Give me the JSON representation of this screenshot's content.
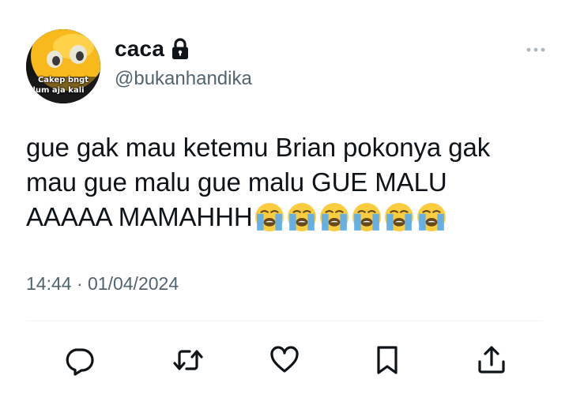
{
  "author": {
    "display_name": "caca",
    "handle": "@bukanhandika",
    "avatar_caption_line1": "Cakep bngt",
    "avatar_caption_line2": "lum aja kali",
    "protected_icon": "lock-icon"
  },
  "tweet": {
    "text_line1": "gue gak mau ketemu Brian pokonya gak",
    "text_line2": "mau gue malu gue malu GUE MALU",
    "text_line3": "AAAAA MAMAHHH",
    "emojis": [
      "loudly-crying-face",
      "loudly-crying-face",
      "loudly-crying-face",
      "loudly-crying-face",
      "loudly-crying-face",
      "loudly-crying-face"
    ],
    "timestamp": "14:44 · 01/04/2024"
  },
  "actions": [
    "reply-icon",
    "retweet-icon",
    "like-icon",
    "bookmark-icon",
    "share-icon"
  ],
  "colors": {
    "text": "#0f1419",
    "secondary": "#536471",
    "divider": "#eff3f4"
  }
}
